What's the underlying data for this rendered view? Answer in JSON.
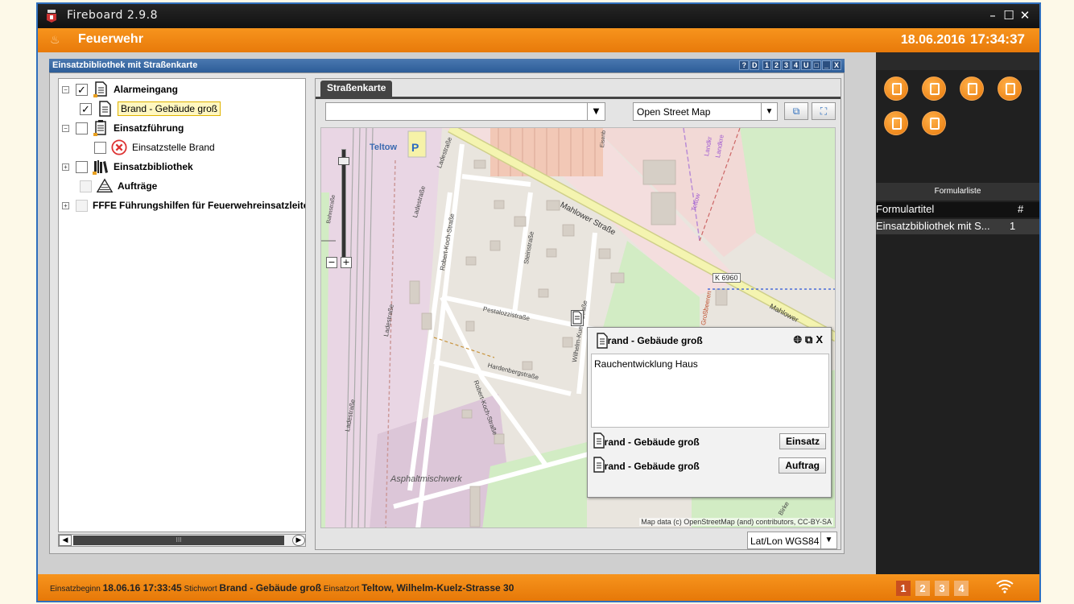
{
  "app": {
    "title": "Fireboard 2.9.8"
  },
  "header": {
    "org": "Feuerwehr",
    "date": "18.06.2016",
    "time": "17:34:37"
  },
  "panel": {
    "title": "Einsatzbibliothek mit Straßenkarte",
    "controls": [
      "?",
      "D",
      "1",
      "2",
      "3",
      "4",
      "U",
      "□",
      "_",
      "X"
    ]
  },
  "tree": {
    "items": [
      {
        "label": "Alarmeingang",
        "checked": true,
        "bold": true,
        "expander": "⊟"
      },
      {
        "label": "Brand - Gebäude groß",
        "checked": true,
        "bold": false
      },
      {
        "label": "Einsatzführung",
        "checked": false,
        "bold": true,
        "expander": "⊟"
      },
      {
        "label": "Einsatzstelle Brand",
        "checked": false,
        "bold": false
      },
      {
        "label": "Einsatzbibliothek",
        "checked": false,
        "bold": true,
        "expander": "⊞"
      },
      {
        "label": "Aufträge",
        "checked": false,
        "bold": true
      },
      {
        "label": "Führungshilfen für Feuerwehreinsatzleiter",
        "prefix": "FFFE",
        "checked": false,
        "bold": true,
        "expander": "⊞"
      }
    ],
    "scroll_thumb": "III"
  },
  "map": {
    "tab": "Straßenkarte",
    "source": "Open Street Map",
    "coord_system": "Lat/Lon WGS84",
    "attribution": "Map data (c) OpenStreetMap (and) contributors, CC-BY-SA",
    "labels": {
      "teltow": "Teltow",
      "parking": "P",
      "mahlower": "Mahlower Straße",
      "ladestrasse": "Ladestraße",
      "ladestrasse2": "Ladestraße",
      "ladestrasse3": "Ladestraße",
      "ladestrasse4": "Ladestraße",
      "robertkoch": "Robert-Koch-Straße",
      "robertkoch2": "Robert-Koch-Straße",
      "stein": "Steinstraße",
      "pestalozzi": "Pestalozzistraße",
      "hardenberg": "Hardenbergstraße",
      "wilhelm": "Wilhelm-Kuelz-Straße",
      "asphalt": "Asphaltmischwerk",
      "k6960": "K 6960",
      "bahn": "Bahnstraße",
      "eisen": "Eisenb",
      "landkr": "Landkr",
      "landkr2": "Landkre",
      "teltow_e": "Teltow",
      "grossbeeren": "Großbeeren",
      "mahlower2": "Mahlower",
      "birke": "Birke"
    }
  },
  "popup": {
    "title": "Brand - Gebäude groß",
    "text": "Rauchentwicklung Haus",
    "rows": [
      {
        "label": "Brand - Gebäude groß",
        "button": "Einsatz"
      },
      {
        "label": "Brand - Gebäude groß",
        "button": "Auftrag"
      }
    ]
  },
  "formlist": {
    "title": "Formularliste",
    "col1": "Formulartitel",
    "col2": "#",
    "rows": [
      {
        "title": "Einsatzbibliothek mit S...",
        "count": "1"
      }
    ]
  },
  "status": {
    "begin_label": "Einsatzbeginn",
    "begin_value": "18.06.16 17:33:45",
    "keyword_label": "Stichwort",
    "keyword_value": "Brand - Gebäude groß",
    "place_label": "Einsatzort",
    "place_value": "Teltow, Wilhelm-Kuelz-Strasse 30",
    "pages": [
      "1",
      "2",
      "3",
      "4"
    ],
    "active_page": "1"
  },
  "colors": {
    "accent": "#f7941d",
    "titlebar": "#1a1a1a",
    "panel_blue": "#3a6aa6"
  }
}
